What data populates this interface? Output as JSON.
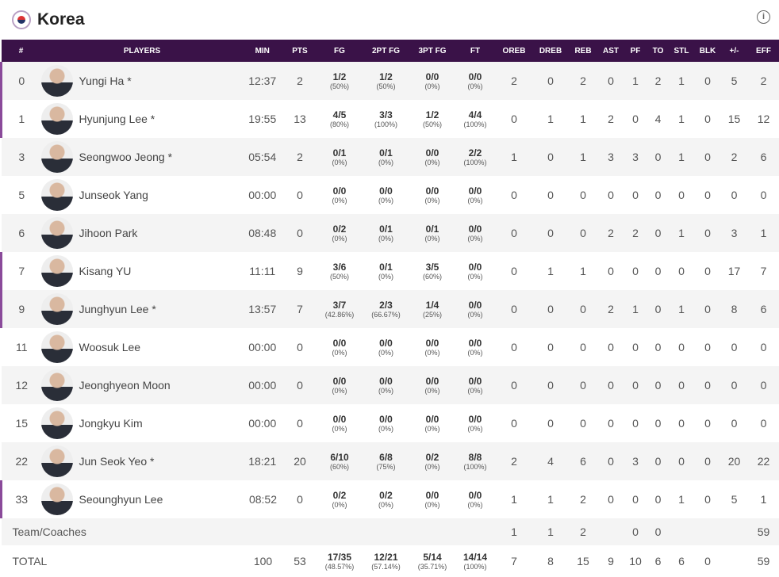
{
  "header": {
    "title": "Korea",
    "info_icon": "i"
  },
  "columns": [
    "#",
    "PLAYERS",
    "MIN",
    "PTS",
    "FG",
    "2PT FG",
    "3PT FG",
    "FT",
    "OREB",
    "DREB",
    "REB",
    "AST",
    "PF",
    "TO",
    "STL",
    "BLK",
    "+/-",
    "EFF"
  ],
  "players": [
    {
      "no": "0",
      "name": "Yungi Ha *",
      "on": true,
      "min": "12:37",
      "pts": "2",
      "fg": [
        "1/2",
        "(50%)"
      ],
      "fg2": [
        "1/2",
        "(50%)"
      ],
      "fg3": [
        "0/0",
        "(0%)"
      ],
      "ft": [
        "0/0",
        "(0%)"
      ],
      "s": [
        "2",
        "0",
        "2",
        "0",
        "1",
        "2",
        "1",
        "0",
        "5",
        "2"
      ]
    },
    {
      "no": "1",
      "name": "Hyunjung Lee *",
      "on": true,
      "min": "19:55",
      "pts": "13",
      "fg": [
        "4/5",
        "(80%)"
      ],
      "fg2": [
        "3/3",
        "(100%)"
      ],
      "fg3": [
        "1/2",
        "(50%)"
      ],
      "ft": [
        "4/4",
        "(100%)"
      ],
      "s": [
        "0",
        "1",
        "1",
        "2",
        "0",
        "4",
        "1",
        "0",
        "15",
        "12"
      ]
    },
    {
      "no": "3",
      "name": "Seongwoo Jeong *",
      "on": false,
      "min": "05:54",
      "pts": "2",
      "fg": [
        "0/1",
        "(0%)"
      ],
      "fg2": [
        "0/1",
        "(0%)"
      ],
      "fg3": [
        "0/0",
        "(0%)"
      ],
      "ft": [
        "2/2",
        "(100%)"
      ],
      "s": [
        "1",
        "0",
        "1",
        "3",
        "3",
        "0",
        "1",
        "0",
        "2",
        "6"
      ]
    },
    {
      "no": "5",
      "name": "Junseok Yang",
      "on": false,
      "min": "00:00",
      "pts": "0",
      "fg": [
        "0/0",
        "(0%)"
      ],
      "fg2": [
        "0/0",
        "(0%)"
      ],
      "fg3": [
        "0/0",
        "(0%)"
      ],
      "ft": [
        "0/0",
        "(0%)"
      ],
      "s": [
        "0",
        "0",
        "0",
        "0",
        "0",
        "0",
        "0",
        "0",
        "0",
        "0"
      ]
    },
    {
      "no": "6",
      "name": "Jihoon Park",
      "on": false,
      "min": "08:48",
      "pts": "0",
      "fg": [
        "0/2",
        "(0%)"
      ],
      "fg2": [
        "0/1",
        "(0%)"
      ],
      "fg3": [
        "0/1",
        "(0%)"
      ],
      "ft": [
        "0/0",
        "(0%)"
      ],
      "s": [
        "0",
        "0",
        "0",
        "2",
        "2",
        "0",
        "1",
        "0",
        "3",
        "1"
      ]
    },
    {
      "no": "7",
      "name": "Kisang YU",
      "on": true,
      "min": "11:11",
      "pts": "9",
      "fg": [
        "3/6",
        "(50%)"
      ],
      "fg2": [
        "0/1",
        "(0%)"
      ],
      "fg3": [
        "3/5",
        "(60%)"
      ],
      "ft": [
        "0/0",
        "(0%)"
      ],
      "s": [
        "0",
        "1",
        "1",
        "0",
        "0",
        "0",
        "0",
        "0",
        "17",
        "7"
      ]
    },
    {
      "no": "9",
      "name": "Junghyun Lee *",
      "on": true,
      "min": "13:57",
      "pts": "7",
      "fg": [
        "3/7",
        "(42.86%)"
      ],
      "fg2": [
        "2/3",
        "(66.67%)"
      ],
      "fg3": [
        "1/4",
        "(25%)"
      ],
      "ft": [
        "0/0",
        "(0%)"
      ],
      "s": [
        "0",
        "0",
        "0",
        "2",
        "1",
        "0",
        "1",
        "0",
        "8",
        "6"
      ]
    },
    {
      "no": "11",
      "name": "Woosuk Lee",
      "on": false,
      "min": "00:00",
      "pts": "0",
      "fg": [
        "0/0",
        "(0%)"
      ],
      "fg2": [
        "0/0",
        "(0%)"
      ],
      "fg3": [
        "0/0",
        "(0%)"
      ],
      "ft": [
        "0/0",
        "(0%)"
      ],
      "s": [
        "0",
        "0",
        "0",
        "0",
        "0",
        "0",
        "0",
        "0",
        "0",
        "0"
      ]
    },
    {
      "no": "12",
      "name": "Jeonghyeon Moon",
      "on": false,
      "min": "00:00",
      "pts": "0",
      "fg": [
        "0/0",
        "(0%)"
      ],
      "fg2": [
        "0/0",
        "(0%)"
      ],
      "fg3": [
        "0/0",
        "(0%)"
      ],
      "ft": [
        "0/0",
        "(0%)"
      ],
      "s": [
        "0",
        "0",
        "0",
        "0",
        "0",
        "0",
        "0",
        "0",
        "0",
        "0"
      ]
    },
    {
      "no": "15",
      "name": "Jongkyu Kim",
      "on": false,
      "min": "00:00",
      "pts": "0",
      "fg": [
        "0/0",
        "(0%)"
      ],
      "fg2": [
        "0/0",
        "(0%)"
      ],
      "fg3": [
        "0/0",
        "(0%)"
      ],
      "ft": [
        "0/0",
        "(0%)"
      ],
      "s": [
        "0",
        "0",
        "0",
        "0",
        "0",
        "0",
        "0",
        "0",
        "0",
        "0"
      ]
    },
    {
      "no": "22",
      "name": "Jun Seok Yeo *",
      "on": false,
      "min": "18:21",
      "pts": "20",
      "fg": [
        "6/10",
        "(60%)"
      ],
      "fg2": [
        "6/8",
        "(75%)"
      ],
      "fg3": [
        "0/2",
        "(0%)"
      ],
      "ft": [
        "8/8",
        "(100%)"
      ],
      "s": [
        "2",
        "4",
        "6",
        "0",
        "3",
        "0",
        "0",
        "0",
        "20",
        "22"
      ]
    },
    {
      "no": "33",
      "name": "Seounghyun Lee",
      "on": true,
      "min": "08:52",
      "pts": "0",
      "fg": [
        "0/2",
        "(0%)"
      ],
      "fg2": [
        "0/2",
        "(0%)"
      ],
      "fg3": [
        "0/0",
        "(0%)"
      ],
      "ft": [
        "0/0",
        "(0%)"
      ],
      "s": [
        "1",
        "1",
        "2",
        "0",
        "0",
        "0",
        "1",
        "0",
        "5",
        "1"
      ]
    }
  ],
  "team": {
    "label": "Team/Coaches",
    "s": [
      "1",
      "1",
      "2",
      "",
      "0",
      "0",
      "",
      "",
      "",
      "59"
    ]
  },
  "total": {
    "label": "TOTAL",
    "min": "100",
    "pts": "53",
    "fg": [
      "17/35",
      "(48.57%)"
    ],
    "fg2": [
      "12/21",
      "(57.14%)"
    ],
    "fg3": [
      "5/14",
      "(35.71%)"
    ],
    "ft": [
      "14/14",
      "(100%)"
    ],
    "s": [
      "7",
      "8",
      "15",
      "9",
      "10",
      "6",
      "6",
      "0",
      "",
      "59"
    ]
  }
}
